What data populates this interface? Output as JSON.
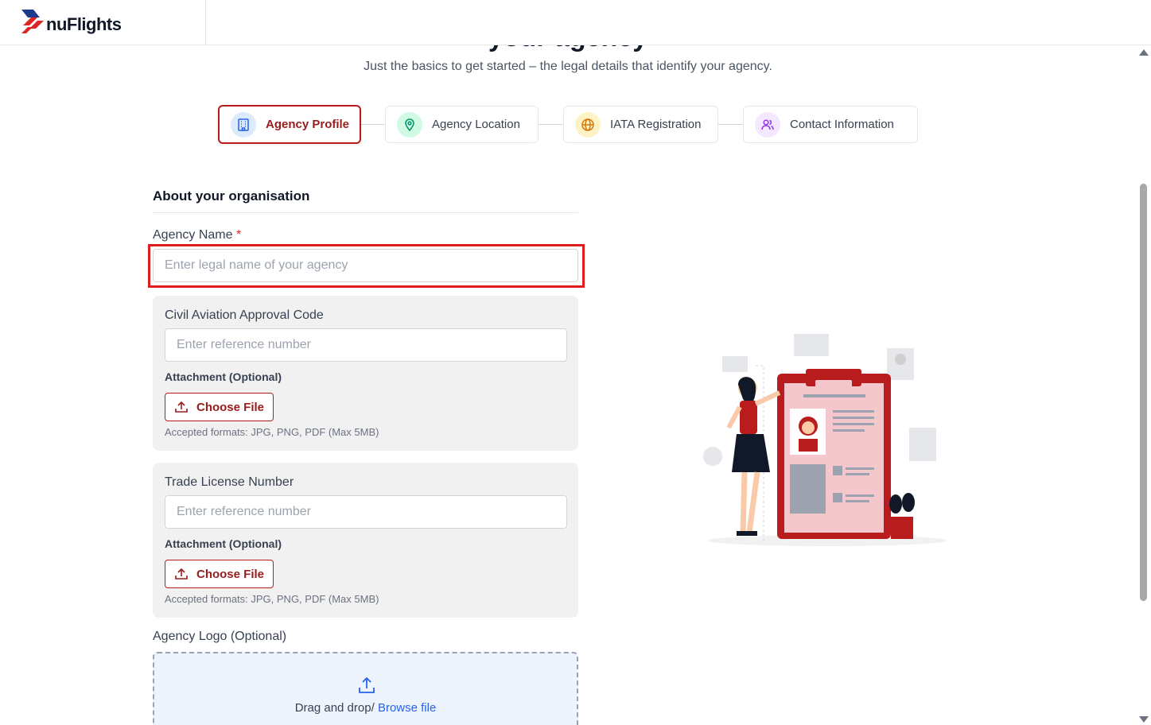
{
  "brand": {
    "name": "nuFlights",
    "accent": "#b91c1c"
  },
  "page": {
    "title_partial": "your agency",
    "subtitle": "Just the basics to get started – the legal details that identify your agency."
  },
  "steps": [
    {
      "label": "Agency Profile",
      "icon": "building-icon",
      "active": true
    },
    {
      "label": "Agency Location",
      "icon": "location-pin-icon",
      "active": false
    },
    {
      "label": "IATA Registration",
      "icon": "globe-icon",
      "active": false
    },
    {
      "label": "Contact Information",
      "icon": "users-icon",
      "active": false
    }
  ],
  "form": {
    "section_title": "About your organisation",
    "agency_name": {
      "label": "Agency Name",
      "required_mark": "*",
      "placeholder": "Enter legal name of your agency",
      "value": ""
    },
    "civil_aviation": {
      "label": "Civil Aviation Approval Code",
      "placeholder": "Enter reference number",
      "attachment_label": "Attachment (Optional)",
      "choose_label": "Choose File",
      "hint": "Accepted formats: JPG, PNG, PDF (Max 5MB)"
    },
    "trade_license": {
      "label": "Trade License Number",
      "placeholder": "Enter reference number",
      "attachment_label": "Attachment (Optional)",
      "choose_label": "Choose File",
      "hint": "Accepted formats: JPG, PNG, PDF (Max 5MB)"
    },
    "logo": {
      "label": "Agency Logo (Optional)",
      "drop_text": "Drag and drop/",
      "browse_text": "Browse file"
    }
  }
}
